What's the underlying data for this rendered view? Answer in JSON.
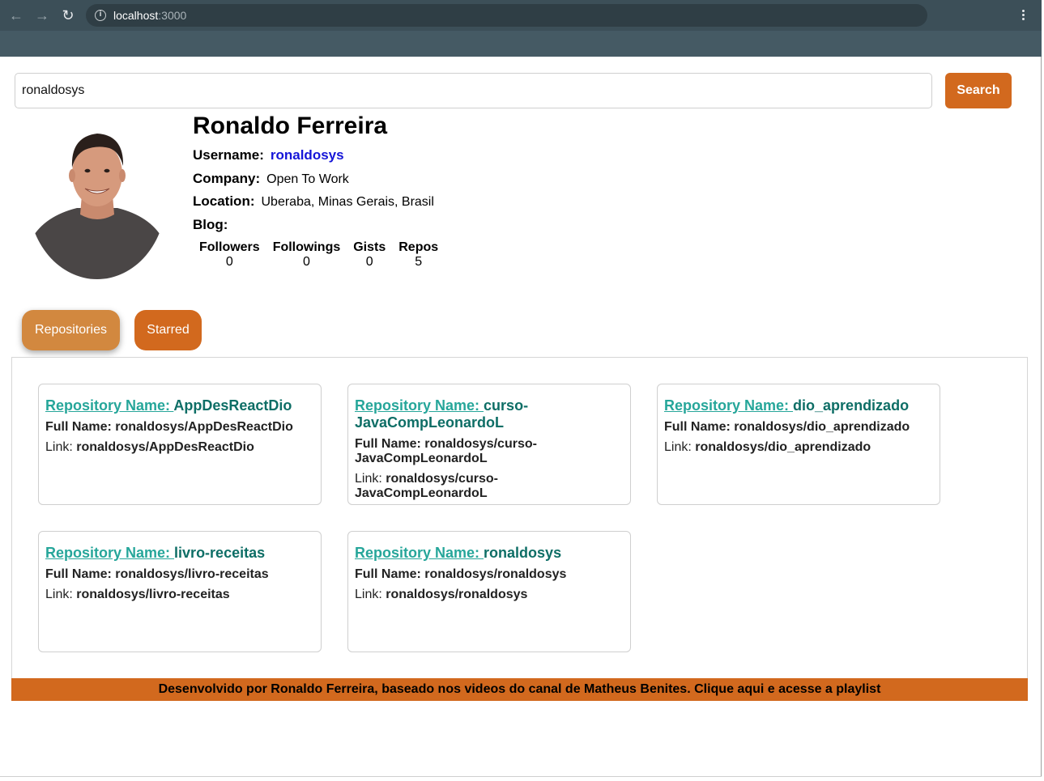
{
  "browser": {
    "url_host": "localhost",
    "url_port": ":3000",
    "icons": [
      "back-icon",
      "forward-icon",
      "reload-icon",
      "info-icon",
      "menu-icon"
    ]
  },
  "search": {
    "value": "ronaldosys",
    "button_label": "Search"
  },
  "profile": {
    "name": "Ronaldo Ferreira",
    "username_label": "Username:",
    "username": "ronaldosys",
    "company_label": "Company:",
    "company": "Open To Work",
    "location_label": "Location:",
    "location": "Uberaba, Minas Gerais, Brasil",
    "blog_label": "Blog:",
    "blog": "",
    "stats": [
      {
        "label": "Followers",
        "value": "0"
      },
      {
        "label": "Followings",
        "value": "0"
      },
      {
        "label": "Gists",
        "value": "0"
      },
      {
        "label": "Repos",
        "value": "5"
      }
    ]
  },
  "tabs": [
    {
      "label": "Repositories",
      "active": true
    },
    {
      "label": "Starred",
      "active": false
    }
  ],
  "repo_name_prefix": "Repository Name: ",
  "full_name_prefix": "Full Name: ",
  "link_prefix": "Link: ",
  "repositories": [
    {
      "name": "AppDesReactDio",
      "full_name": "ronaldosys/AppDesReactDio",
      "link": "ronaldosys/AppDesReactDio"
    },
    {
      "name": "curso-JavaCompLeonardoL",
      "full_name": "ronaldosys/curso-JavaCompLeonardoL",
      "link": "ronaldosys/curso-JavaCompLeonardoL"
    },
    {
      "name": "dio_aprendizado",
      "full_name": "ronaldosys/dio_aprendizado",
      "link": "ronaldosys/dio_aprendizado"
    },
    {
      "name": "livro-receitas",
      "full_name": "ronaldosys/livro-receitas",
      "link": "ronaldosys/livro-receitas"
    },
    {
      "name": "ronaldosys",
      "full_name": "ronaldosys/ronaldosys",
      "link": "ronaldosys/ronaldosys"
    }
  ],
  "footer": {
    "text": "Desenvolvido por Ronaldo Ferreira, baseado nos videos do canal de Matheus Benites. Clique aqui e acesse a playlist"
  },
  "colors": {
    "accent": "#d2691e",
    "active_tab": "#d2883f",
    "repo_title": "#0e6e66",
    "repo_prefix": "#26a69a",
    "username_link": "#1515d8",
    "chrome": "#455a64"
  }
}
